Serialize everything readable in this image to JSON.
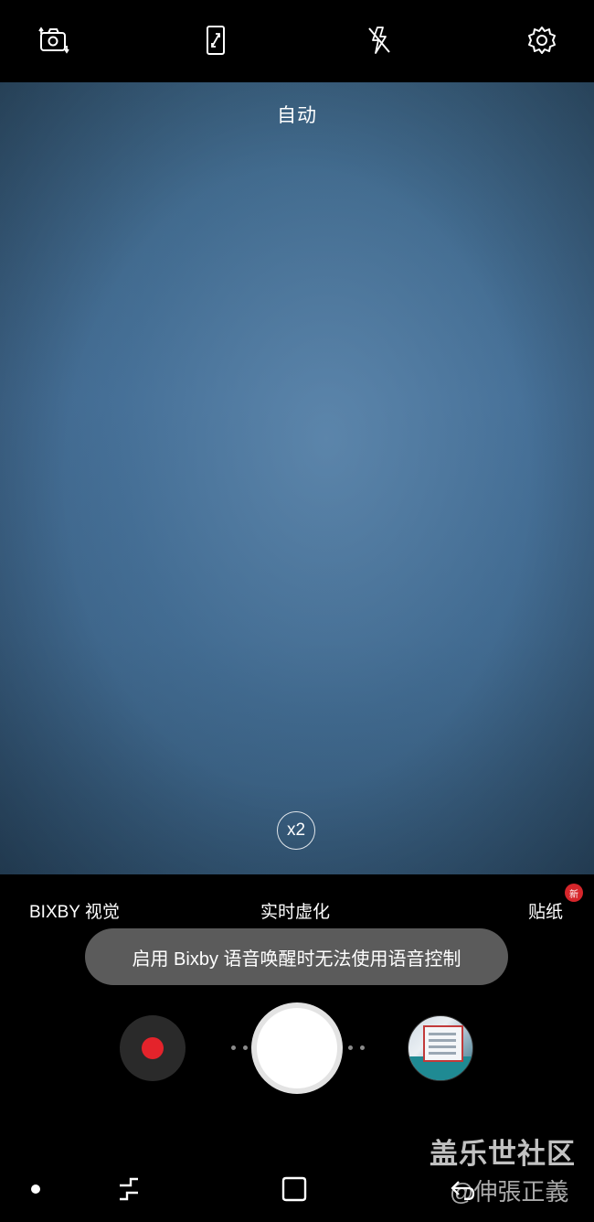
{
  "top_bar": {
    "icons": [
      "switch-camera-icon",
      "aspect-ratio-icon",
      "flash-off-icon",
      "settings-icon"
    ]
  },
  "viewfinder": {
    "mode_label": "自动",
    "zoom_label": "x2"
  },
  "modes": {
    "left": "BIXBY 视觉",
    "center": "实时虚化",
    "right": "贴纸",
    "new_badge": "新"
  },
  "toast": {
    "message": "启用 Bixby 语音唤醒时无法使用语音控制"
  },
  "colors": {
    "record_dot": "#e4232b",
    "badge": "#d6262b",
    "viewfinder_blue": "#46719a"
  },
  "watermark": {
    "line1": "盖乐世社区",
    "line2": "@伸張正義"
  },
  "nav_bar": {
    "icons": [
      "nav-dot-icon",
      "recent-apps-icon",
      "home-icon",
      "back-icon"
    ]
  }
}
